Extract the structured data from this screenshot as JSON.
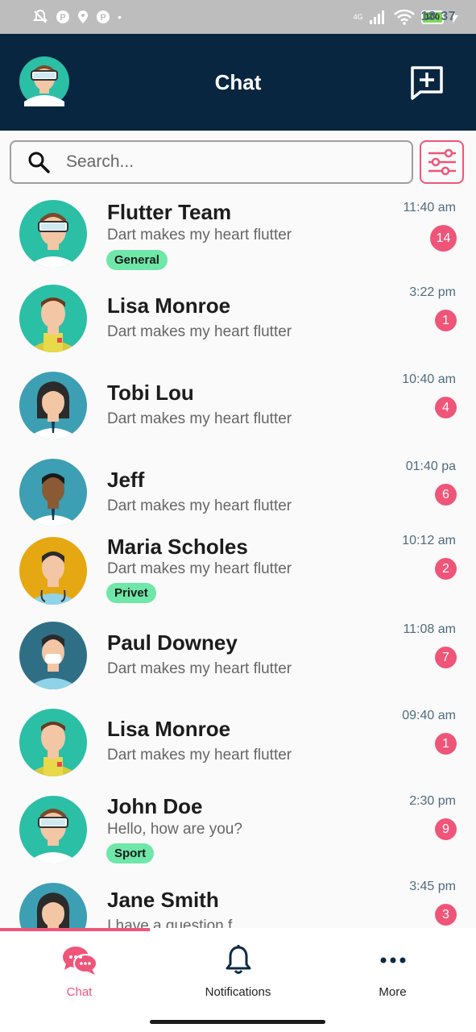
{
  "status": {
    "time": "18:37",
    "battery": "100",
    "network": "4G"
  },
  "header": {
    "title": "Chat"
  },
  "search": {
    "placeholder": "Search..."
  },
  "chats": [
    {
      "name": "Flutter Team",
      "message": "Dart makes my heart flutter",
      "time": "11:40 am",
      "unread": "14",
      "tag": "General"
    },
    {
      "name": "Lisa Monroe",
      "message": "Dart makes my heart flutter",
      "time": "3:22 pm",
      "unread": "1",
      "tag": ""
    },
    {
      "name": "Tobi Lou",
      "message": "Dart makes my heart flutter",
      "time": "10:40 am",
      "unread": "4",
      "tag": ""
    },
    {
      "name": "Jeff",
      "message": "Dart makes my heart flutter",
      "time": "01:40 pa",
      "unread": "6",
      "tag": ""
    },
    {
      "name": "Maria Scholes",
      "message": "Dart makes my heart flutter",
      "time": "10:12 am",
      "unread": "2",
      "tag": "Privet"
    },
    {
      "name": "Paul Downey",
      "message": "Dart makes my heart flutter",
      "time": "11:08 am",
      "unread": "7",
      "tag": ""
    },
    {
      "name": "Lisa Monroe",
      "message": "Dart makes my heart flutter",
      "time": "09:40 am",
      "unread": "1",
      "tag": ""
    },
    {
      "name": "John Doe",
      "message": "Hello, how are you?",
      "time": "2:30 pm",
      "unread": "9",
      "tag": "Sport"
    },
    {
      "name": "Jane Smith",
      "message": "I have a question f...",
      "time": "3:45 pm",
      "unread": "3",
      "tag": ""
    }
  ],
  "nav": [
    {
      "label": "Chat",
      "icon": "chat-bubbles-icon",
      "active": true
    },
    {
      "label": "Notifications",
      "icon": "bell-icon",
      "active": false
    },
    {
      "label": "More",
      "icon": "more-horizontal-icon",
      "active": false
    }
  ],
  "colors": {
    "appbar": "#082640",
    "accent": "#ef5579",
    "tag": "#6ee7a8"
  }
}
